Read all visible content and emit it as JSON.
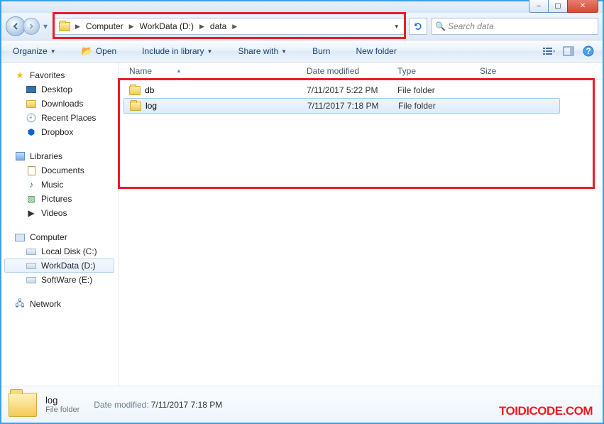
{
  "window": {
    "min": "–",
    "max": "▢",
    "close": "✕"
  },
  "breadcrumb": [
    "Computer",
    "WorkData (D:)",
    "data"
  ],
  "search": {
    "placeholder": "Search data"
  },
  "toolbar": {
    "organize": "Organize",
    "open": "Open",
    "include": "Include in library",
    "share": "Share with",
    "burn": "Burn",
    "newfolder": "New folder"
  },
  "sidebar": {
    "favorites": {
      "label": "Favorites",
      "items": [
        "Desktop",
        "Downloads",
        "Recent Places",
        "Dropbox"
      ]
    },
    "libraries": {
      "label": "Libraries",
      "items": [
        "Documents",
        "Music",
        "Pictures",
        "Videos"
      ]
    },
    "computer": {
      "label": "Computer",
      "items": [
        "Local Disk (C:)",
        "WorkData (D:)",
        "SoftWare (E:)"
      ]
    },
    "network": {
      "label": "Network"
    }
  },
  "columns": {
    "name": "Name",
    "date": "Date modified",
    "type": "Type",
    "size": "Size"
  },
  "files": [
    {
      "name": "db",
      "date": "7/11/2017 5:22 PM",
      "type": "File folder"
    },
    {
      "name": "log",
      "date": "7/11/2017 7:18 PM",
      "type": "File folder"
    }
  ],
  "details": {
    "name": "log",
    "type": "File folder",
    "date_label": "Date modified:",
    "date": "7/11/2017 7:18 PM"
  },
  "watermark": "TOIDICODE.COM"
}
